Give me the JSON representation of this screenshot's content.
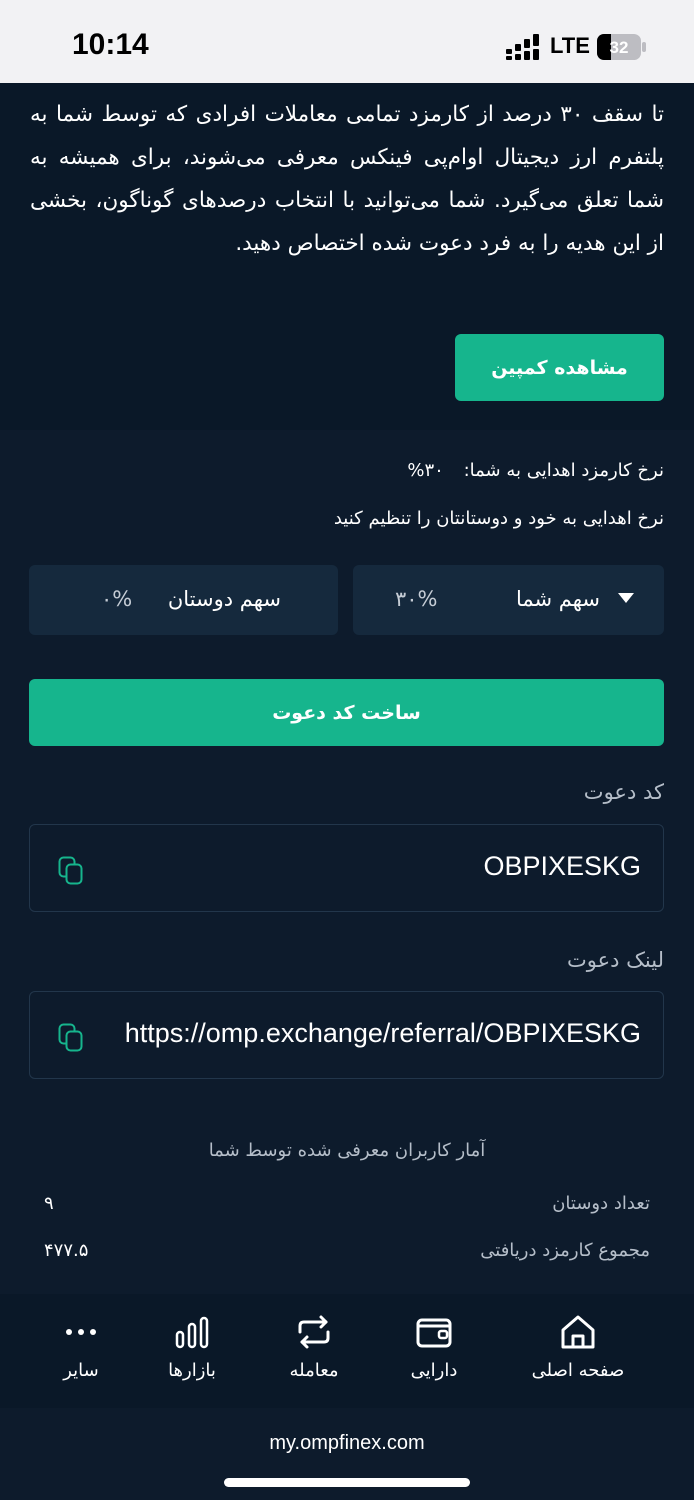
{
  "status_bar": {
    "time": "10:14",
    "network": "LTE",
    "battery": "32"
  },
  "intro": {
    "text": "تا سقف ۳۰ درصد از کارمزد تمامی معاملات افرادی که توسط شما به پلتفرم ارز دیجیتال اوام‌پی فینکس معرفی می‌شوند، برای همیشه به شما تعلق می‌گیرد. شما می‌توانید با انتخاب درصدهای گوناگون، بخشی از این هدیه را به فرد دعوت شده اختصاص دهید.",
    "campaign_button": "مشاهده کمپین"
  },
  "commission": {
    "rate_label": "نرخ کارمزد اهدایی به شما:",
    "rate_value": "۳۰%",
    "set_text": "نرخ اهدایی به خود و دوستانتان را تنظیم کنید"
  },
  "share": {
    "you_label": "سهم شما",
    "you_value": "۳۰%",
    "friends_label": "سهم دوستان",
    "friends_value": "۰%"
  },
  "create_button": "ساخت کد دعوت",
  "invite_code": {
    "label": "کد دعوت",
    "value": "OBPIXESKG"
  },
  "invite_link": {
    "label": "لینک دعوت",
    "value": "https://omp.exchange/referral/OBPIXESKG"
  },
  "stats": {
    "title": "آمار کاربران معرفی شده توسط شما",
    "friends_count_label": "تعداد دوستان",
    "friends_count_value": "۹",
    "total_fee_label": "مجموع کارمزد دریافتی",
    "total_fee_value": "۴۷۷.۵"
  },
  "nav": {
    "home": "صفحه اصلی",
    "assets": "دارایی",
    "trade": "معامله",
    "markets": "بازارها",
    "more": "سایر"
  },
  "browser": {
    "url": "my.ompfinex.com"
  },
  "colors": {
    "accent": "#16b58d",
    "background": "#0d1b2c",
    "panel": "#15293d"
  }
}
